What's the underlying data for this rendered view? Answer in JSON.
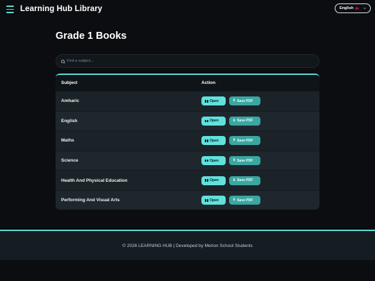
{
  "header": {
    "brand": "Learning Hub Library",
    "language": "English"
  },
  "main": {
    "title": "Grade 1 Books",
    "search": {
      "placeholder": "Find a subject...",
      "value": ""
    },
    "table": {
      "columns": [
        "Subject",
        "Action"
      ],
      "open_label": "Open",
      "save_label": "Save PDF",
      "rows": [
        "Amharic",
        "English",
        "Maths",
        "Science",
        "Health And Physical Education",
        "Performing And Visual Arts"
      ]
    }
  },
  "footer": {
    "text": "© 2026 LEARNING HUB | Developed by Merion School Students"
  },
  "colors": {
    "accent": "#5fd9d4",
    "background": "#0b0d10",
    "card": "#1b2329"
  }
}
